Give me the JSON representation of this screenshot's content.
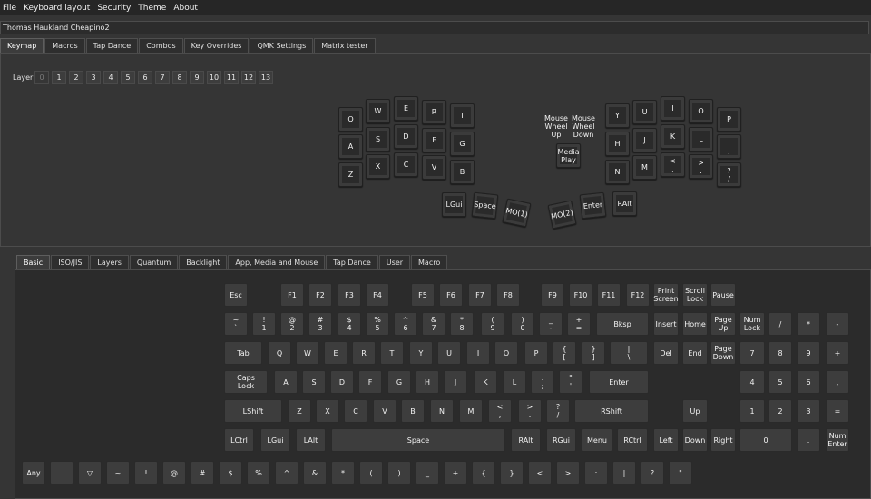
{
  "menu": [
    "File",
    "Keyboard layout",
    "Security",
    "Theme",
    "About"
  ],
  "device": "Thomas Haukland Cheapino2",
  "top_tabs": [
    "Keymap",
    "Macros",
    "Tap Dance",
    "Combos",
    "Key Overrides",
    "QMK Settings",
    "Matrix tester"
  ],
  "layer_label": "Layer",
  "layers": [
    "0",
    "1",
    "2",
    "3",
    "4",
    "5",
    "6",
    "7",
    "8",
    "9",
    "10",
    "11",
    "12",
    "13"
  ],
  "split_keys": [
    "Q",
    "W",
    "E",
    "R",
    "T",
    "A",
    "S",
    "D",
    "F",
    "G",
    "Z",
    "X",
    "C",
    "V",
    "B",
    "Mouse\nWheel\nUp",
    "Mouse\nWheel\nDown",
    "Y",
    "U",
    "I",
    "O",
    "P",
    "Media\nPlay",
    "H",
    "J",
    "K",
    "L",
    ":\n;",
    "N",
    "M",
    "<\n,",
    ">\n.",
    "?\n/",
    "LGui",
    "Space",
    "MO(1)",
    "MO(2)",
    "Enter",
    "RAlt"
  ],
  "bottom_tabs": [
    "Basic",
    "ISO/JIS",
    "Layers",
    "Quantum",
    "Backlight",
    "App, Media and Mouse",
    "Tap Dance",
    "User",
    "Macro"
  ],
  "basic_keys": [
    "Esc",
    "F1",
    "F2",
    "F3",
    "F4",
    "F5",
    "F6",
    "F7",
    "F8",
    "F9",
    "F10",
    "F11",
    "F12",
    "Print\nScreen",
    "Scroll\nLock",
    "Pause",
    "~\n`",
    "!\n1",
    "@\n2",
    "#\n3",
    "$\n4",
    "%\n5",
    "^\n6",
    "&\n7",
    "*\n8",
    "(\n9",
    ")\n0",
    "_\n-",
    "+\n=",
    "Bksp",
    "Insert",
    "Home",
    "Page\nUp",
    "Num\nLock",
    "/",
    "*",
    "-",
    "Tab",
    "Q",
    "W",
    "E",
    "R",
    "T",
    "Y",
    "U",
    "I",
    "O",
    "P",
    "{\n[",
    "}\n]",
    "|\n\\",
    "Del",
    "End",
    "Page\nDown",
    "7",
    "8",
    "9",
    "+",
    "Caps\nLock",
    "A",
    "S",
    "D",
    "F",
    "G",
    "H",
    "J",
    "K",
    "L",
    ":\n;",
    "\"\n'",
    "Enter",
    "4",
    "5",
    "6",
    ",",
    "LShift",
    "Z",
    "X",
    "C",
    "V",
    "B",
    "N",
    "M",
    "<\n,",
    ">\n.",
    "?\n/",
    "RShift",
    "Up",
    "1",
    "2",
    "3",
    "=",
    "LCtrl",
    "LGui",
    "LAlt",
    "Space",
    "RAlt",
    "RGui",
    "Menu",
    "RCtrl",
    "Left",
    "Down",
    "Right",
    "0",
    ".",
    "Num\nEnter",
    "Any",
    "",
    "▽",
    "~",
    "!",
    "@",
    "#",
    "$",
    "%",
    "^",
    "&",
    "*",
    "(",
    ")",
    "_",
    "+",
    "{",
    "}",
    "<",
    ">",
    ":",
    "|",
    "?",
    "\""
  ]
}
